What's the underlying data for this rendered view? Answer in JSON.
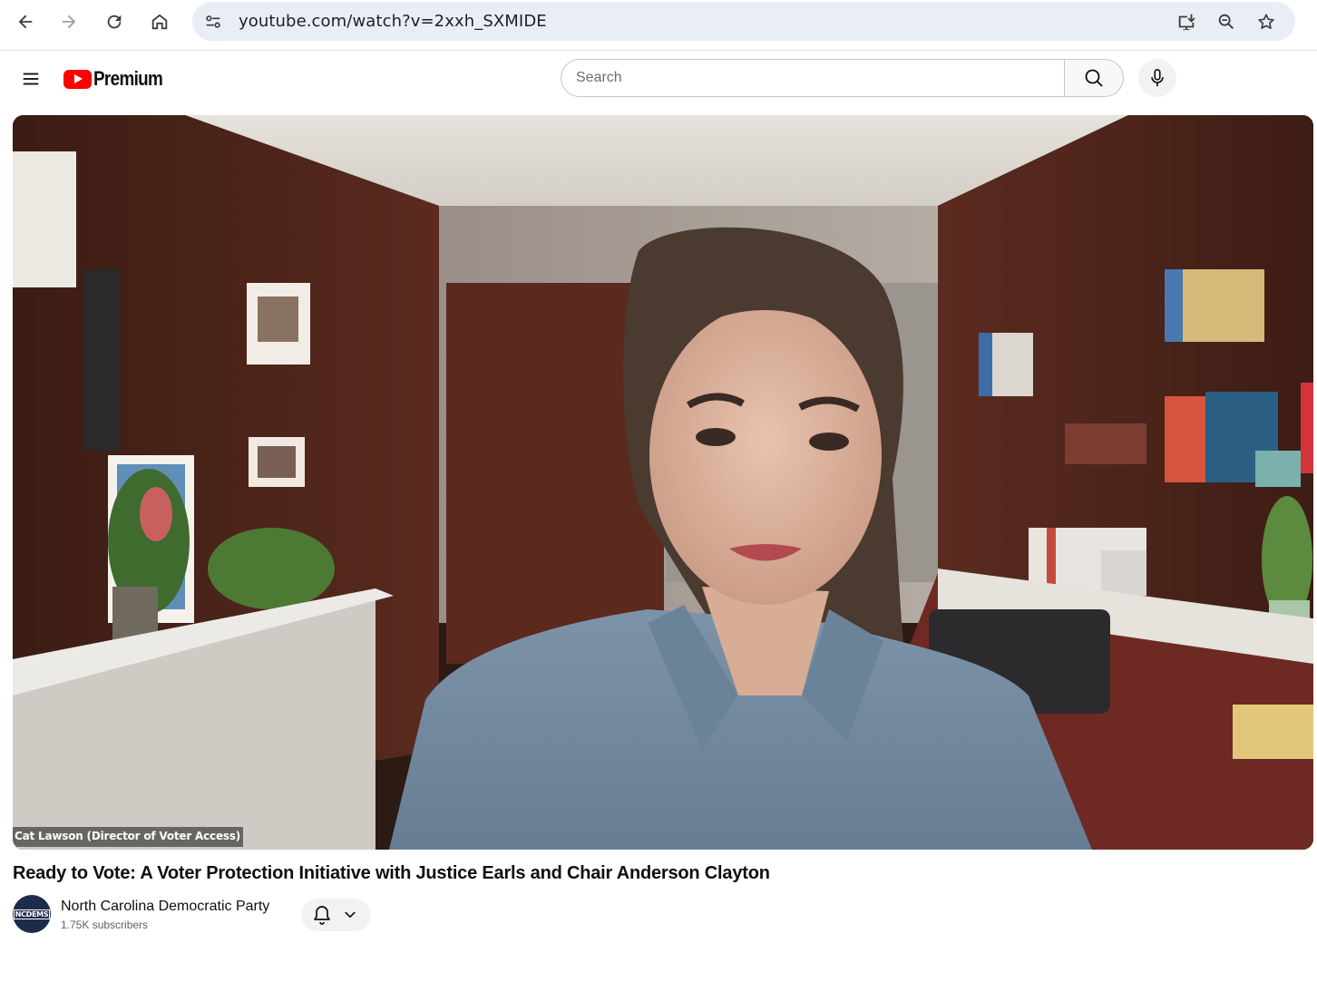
{
  "browser": {
    "url": "youtube.com/watch?v=2xxh_SXMIDE",
    "icons": [
      "back-arrow-icon",
      "forward-arrow-icon",
      "reload-icon",
      "home-icon",
      "site-info-icon",
      "install-app-icon",
      "zoom-icon",
      "bookmark-star-icon"
    ]
  },
  "masthead": {
    "logo_text": "Premium",
    "search_placeholder": "Search",
    "icons": [
      "hamburger-menu-icon",
      "search-icon",
      "microphone-icon"
    ]
  },
  "player": {
    "name_tag": "Cat Lawson (Director of Voter Access)"
  },
  "video": {
    "title": "Ready to Vote: A Voter Protection Initiative with Justice Earls and Chair Anderson Clayton"
  },
  "channel": {
    "avatar_text": "NCDEMS",
    "name": "North Carolina Democratic Party",
    "subscribers": "1.75K subscribers",
    "icons": [
      "bell-icon",
      "chevron-down-icon"
    ]
  },
  "colors": {
    "brand_red": "#ff0000",
    "omnibox_bg": "#e9eef6",
    "text_primary": "#0f0f0f",
    "text_secondary": "#606060"
  }
}
